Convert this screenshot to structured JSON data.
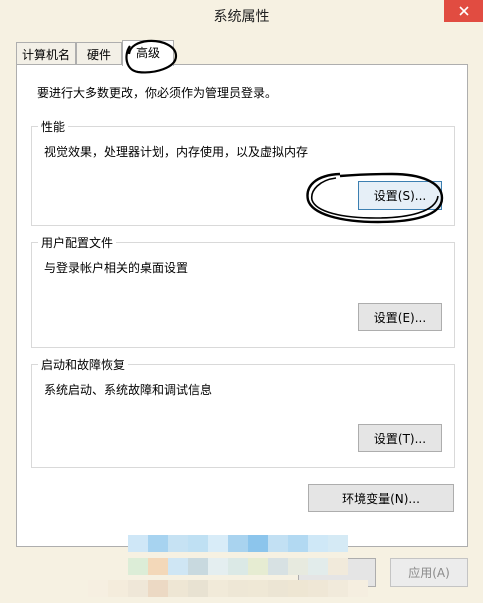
{
  "window": {
    "title": "系统属性"
  },
  "tabs": [
    {
      "label": "计算机名"
    },
    {
      "label": "硬件"
    },
    {
      "label": "高级"
    }
  ],
  "notice": "要进行大多数更改，你必须作为管理员登录。",
  "groups": [
    {
      "title": "性能",
      "description": "视觉效果，处理器计划，内存使用，以及虚拟内存",
      "button": "设置(S)..."
    },
    {
      "title": "用户配置文件",
      "description": "与登录帐户相关的桌面设置",
      "button": "设置(E)..."
    },
    {
      "title": "启动和故障恢复",
      "description": "系统启动、系统故障和调试信息",
      "button": "设置(T)..."
    }
  ],
  "env_button": "环境变量(N)...",
  "footer": {
    "apply_label": "应用(A)"
  },
  "colors": {
    "close": "#e14c41",
    "background": "#f6f1e2",
    "focus_border": "#3c7fb1"
  },
  "icons": {
    "close": "close-icon"
  }
}
